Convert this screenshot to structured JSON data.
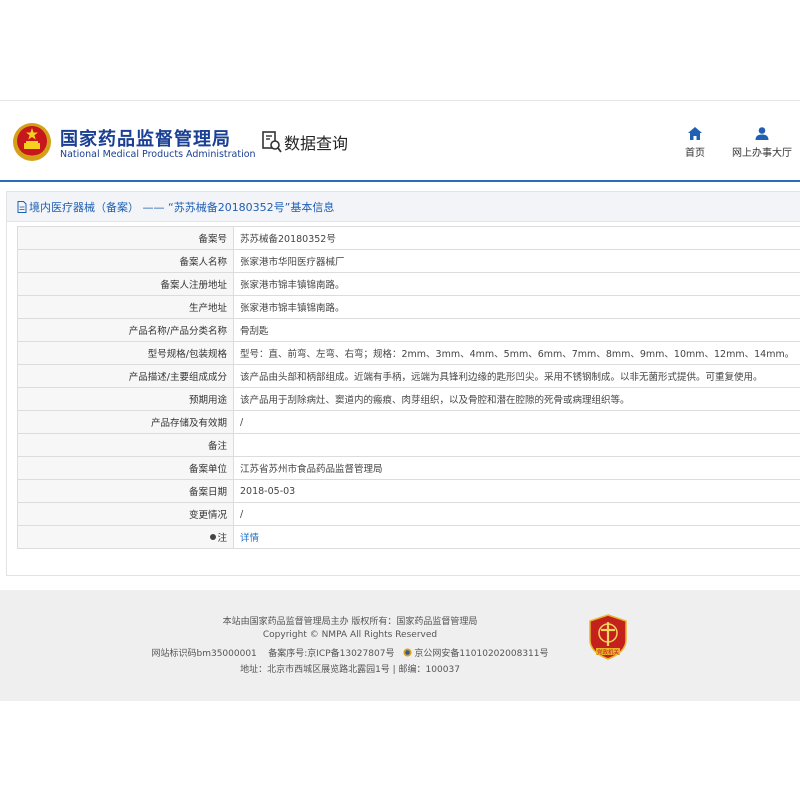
{
  "header": {
    "title_cn": "国家药品监督管理局",
    "title_en": "National Medical Products Administration",
    "query_label": "数据查询",
    "nav": [
      {
        "label": "首页",
        "icon": "home-icon"
      },
      {
        "label": "网上办事大厅",
        "icon": "user-icon"
      }
    ]
  },
  "breadcrumb": "境内医疗器械（备案） —— “苏苏械备20180352号”基本信息",
  "rows": [
    {
      "label": "备案号",
      "value": "苏苏械备20180352号"
    },
    {
      "label": "备案人名称",
      "value": "张家港市华阳医疗器械厂"
    },
    {
      "label": "备案人注册地址",
      "value": "张家港市锦丰镇锦南路。"
    },
    {
      "label": "生产地址",
      "value": "张家港市锦丰镇锦南路。"
    },
    {
      "label": "产品名称/产品分类名称",
      "value": "骨刮匙"
    },
    {
      "label": "型号规格/包装规格",
      "value": "型号：直、前弯、左弯、右弯；规格：2mm、3mm、4mm、5mm、6mm、7mm、8mm、9mm、10mm、12mm、14mm。"
    },
    {
      "label": "产品描述/主要组成成分",
      "value": "该产品由头部和柄部组成。近端有手柄，远端为具锋利边缘的匙形凹尖。采用不锈钢制成。以非无菌形式提供。可重复使用。"
    },
    {
      "label": "预期用途",
      "value": "该产品用于刮除病灶、窦道内的瘢痕、肉芽组织，以及骨腔和潜在腔隙的死骨或病理组织等。"
    },
    {
      "label": "产品存储及有效期",
      "value": "/"
    },
    {
      "label": "备注",
      "value": ""
    },
    {
      "label": "备案单位",
      "value": "江苏省苏州市食品药品监督管理局"
    },
    {
      "label": "备案日期",
      "value": "2018-05-03"
    },
    {
      "label": "变更情况",
      "value": "/"
    },
    {
      "label": "注",
      "value": "详情"
    }
  ],
  "footer": {
    "line1": "本站由国家药品监督管理局主办 版权所有：国家药品监督管理局",
    "line2": "Copyright © NMPA All Rights Reserved",
    "site_id": "网站标识码bm35000001",
    "icp": "备案序号:京ICP备13027807号",
    "police": "京公网安备11010202008311号",
    "address": "地址：北京市西城区展览路北露园1号 | 邮编：100037",
    "badge_label": "党政机关"
  },
  "colors": {
    "brand_blue": "#1a3f94",
    "link_blue": "#1f6fc7",
    "badge_red": "#c4211c"
  }
}
